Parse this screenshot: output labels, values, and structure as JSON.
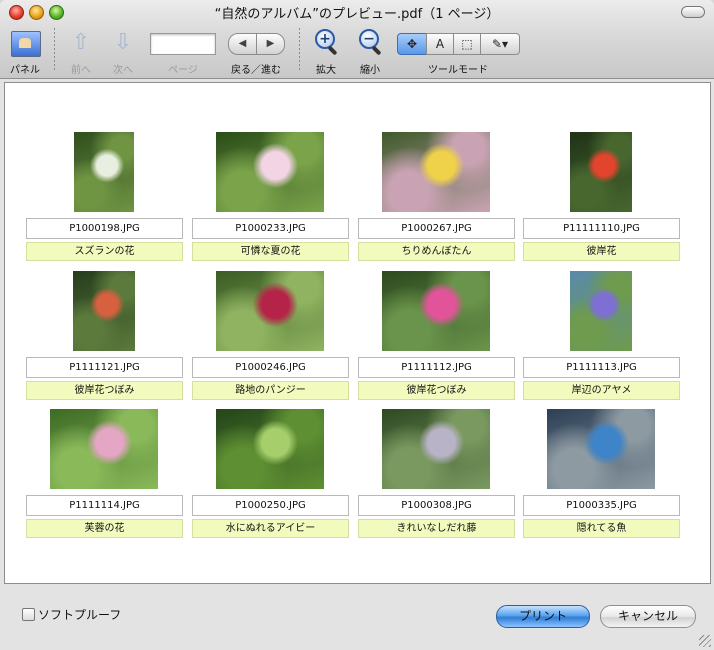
{
  "window": {
    "title": "“自然のアルバム”のプレビュー.pdf（1 ページ）"
  },
  "toolbar": {
    "panel_label": "パネル",
    "prev_label": "前へ",
    "next_label": "次へ",
    "page_label": "ページ",
    "page_value": "",
    "backforward_label": "戻る／進む",
    "back_glyph": "◀",
    "forward_glyph": "▶",
    "zoom_in_label": "拡大",
    "zoom_out_label": "縮小",
    "tool_mode_label": "ツールモード",
    "tools": [
      {
        "icon": "move-icon",
        "glyph": "✥",
        "active": true
      },
      {
        "icon": "text-select-icon",
        "glyph": "A",
        "active": false
      },
      {
        "icon": "marquee-select-icon",
        "glyph": "⬚",
        "active": false
      },
      {
        "icon": "annotate-pen-icon",
        "glyph": "✎▾",
        "active": false
      }
    ]
  },
  "photos": [
    {
      "file": "P1000198.JPG",
      "caption": "スズランの花",
      "colors": [
        "#2f4f1e",
        "#6f9442",
        "#e9efe0"
      ]
    },
    {
      "file": "P1000233.JPG",
      "caption": "可憐な夏の花",
      "colors": [
        "#2b4d18",
        "#7aa34a",
        "#f3d4e4"
      ]
    },
    {
      "file": "P1000267.JPG",
      "caption": "ちりめんぼたん",
      "colors": [
        "#3e5a2a",
        "#c9a3b3",
        "#f0d24a"
      ]
    },
    {
      "file": "P11111110.JPG",
      "caption": "彼岸花",
      "colors": [
        "#1f3318",
        "#48672f",
        "#e2442d"
      ]
    },
    {
      "file": "P1111121.JPG",
      "caption": "彼岸花つぼみ",
      "colors": [
        "#263d1d",
        "#5b7a3c",
        "#d6603f"
      ]
    },
    {
      "file": "P1000246.JPG",
      "caption": "路地のパンジー",
      "colors": [
        "#3b5c24",
        "#8fb360",
        "#b52348"
      ]
    },
    {
      "file": "P1111112.JPG",
      "caption": "彼岸花つぼみ",
      "colors": [
        "#2d4a1e",
        "#6a944b",
        "#e2549a"
      ]
    },
    {
      "file": "P1111113.JPG",
      "caption": "岸辺のアヤメ",
      "colors": [
        "#5a8aa8",
        "#6e9b4d",
        "#7d6fd3"
      ]
    },
    {
      "file": "P1111114.JPG",
      "caption": "芙蓉の花",
      "colors": [
        "#3d6b25",
        "#8ab95a",
        "#e4a6c4"
      ]
    },
    {
      "file": "P1000250.JPG",
      "caption": "水にぬれるアイビー",
      "colors": [
        "#24451a",
        "#5e8f32",
        "#a6cf6c"
      ]
    },
    {
      "file": "P1000308.JPG",
      "caption": "きれいなしだれ藤",
      "colors": [
        "#2f4a23",
        "#7a9960",
        "#b9b3c8"
      ]
    },
    {
      "file": "P1000335.JPG",
      "caption": "隠れてる魚",
      "colors": [
        "#2b3f55",
        "#8d9aa2",
        "#3d84c8"
      ]
    }
  ],
  "footer": {
    "soft_proof_label": "ソフトプルーフ",
    "print_label": "プリント",
    "cancel_label": "キャンセル"
  }
}
